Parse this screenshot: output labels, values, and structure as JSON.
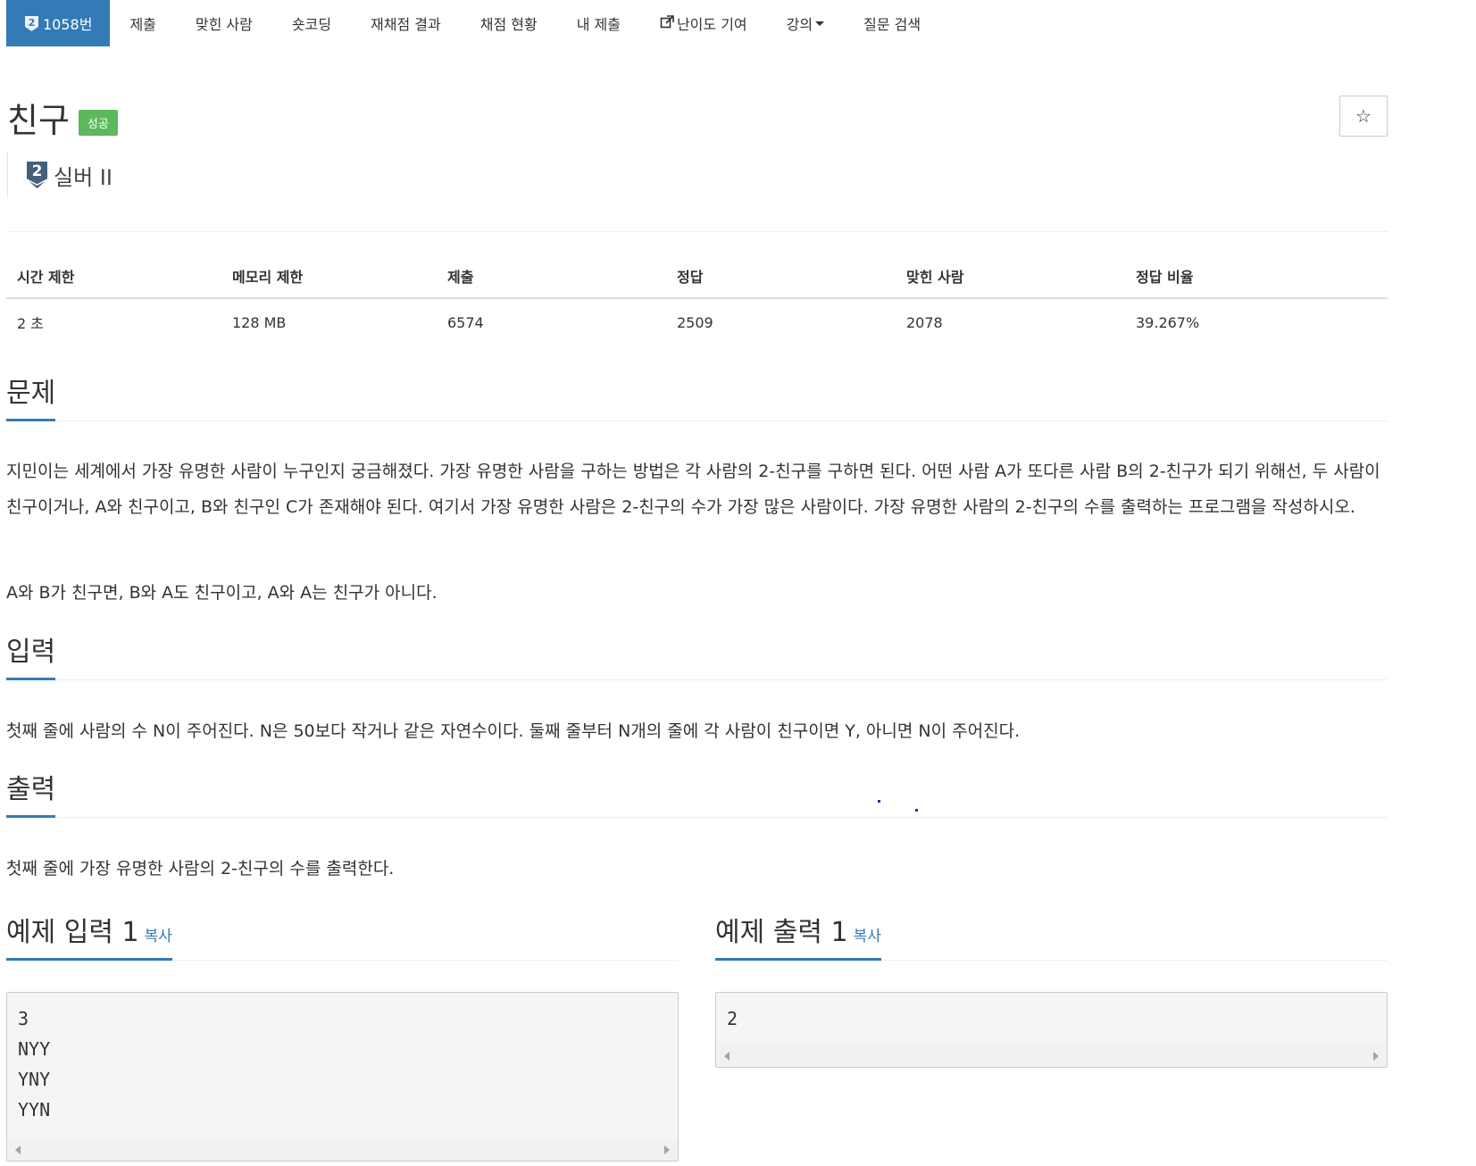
{
  "nav": {
    "problem_number": "1058번",
    "tier_digit": "2",
    "items": [
      "제출",
      "맞힌 사람",
      "숏코딩",
      "재채점 결과",
      "채점 현황",
      "내 제출",
      "난이도 기여",
      "강의",
      "질문 검색"
    ]
  },
  "problem": {
    "title": "친구",
    "status": "성공",
    "star": "☆",
    "tier_digit": "2",
    "tier": "실버 II"
  },
  "info_table": {
    "headers": [
      "시간 제한",
      "메모리 제한",
      "제출",
      "정답",
      "맞힌 사람",
      "정답 비율"
    ],
    "values": [
      "2 초",
      "128 MB",
      "6574",
      "2509",
      "2078",
      "39.267%"
    ]
  },
  "sections": {
    "description": {
      "title": "문제",
      "paragraphs": [
        "지민이는 세계에서 가장 유명한 사람이 누구인지 궁금해졌다. 가장 유명한 사람을 구하는 방법은 각 사람의 2-친구를 구하면 된다. 어떤 사람 A가 또다른 사람 B의 2-친구가 되기 위해선, 두 사람이 친구이거나, A와 친구이고, B와 친구인 C가 존재해야 된다. 여기서 가장 유명한 사람은 2-친구의 수가 가장 많은 사람이다. 가장 유명한 사람의 2-친구의 수를 출력하는 프로그램을 작성하시오.",
        "A와 B가 친구면, B와 A도 친구이고, A와 A는 친구가 아니다."
      ]
    },
    "input": {
      "title": "입력",
      "text": "첫째 줄에 사람의 수 N이 주어진다. N은 50보다 작거나 같은 자연수이다. 둘째 줄부터 N개의 줄에 각 사람이 친구이면 Y, 아니면 N이 주어진다."
    },
    "output": {
      "title": "출력",
      "text": "첫째 줄에 가장 유명한 사람의 2-친구의 수를 출력한다."
    }
  },
  "samples": {
    "copy_label": "복사",
    "input_title": "예제 입력 1",
    "output_title": "예제 출력 1",
    "input_text": "3\nNYY\nYNY\nYYN",
    "output_text": "2"
  },
  "colors": {
    "accent": "#337ab7",
    "success": "#5cb85c",
    "tier_silver": "#435f7a"
  }
}
